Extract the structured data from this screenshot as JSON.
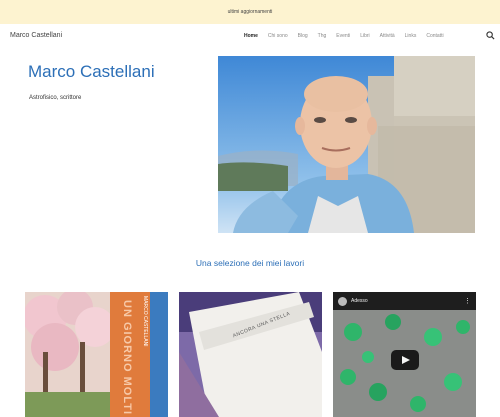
{
  "topbar": {
    "link": "ultimi aggiornamenti"
  },
  "header": {
    "site_title": "Marco Castellani",
    "menu": [
      {
        "label": "Home"
      },
      {
        "label": "Chi sono"
      },
      {
        "label": "Blog"
      },
      {
        "label": "Thg"
      },
      {
        "label": "Eventi"
      },
      {
        "label": "Libri"
      },
      {
        "label": "Attività"
      },
      {
        "label": "Links"
      },
      {
        "label": "Contatti"
      }
    ],
    "search_icon": "search-icon"
  },
  "hero": {
    "name": "Marco Castellani",
    "subtitle": "Astrofisico, scrittore"
  },
  "works": {
    "title": "Una selezione dei miei lavori",
    "items": [
      {
        "kind": "book",
        "cover_text": "UN GIORNO MOLTI",
        "spine_text": "MARCO CASTELLANI"
      },
      {
        "kind": "book",
        "cover_text": "ANCORA UNA STELLA"
      },
      {
        "kind": "video",
        "title": "Adesso"
      }
    ]
  },
  "colors": {
    "accent": "#2c6fb7",
    "topbar_bg": "#fdf3d0"
  }
}
